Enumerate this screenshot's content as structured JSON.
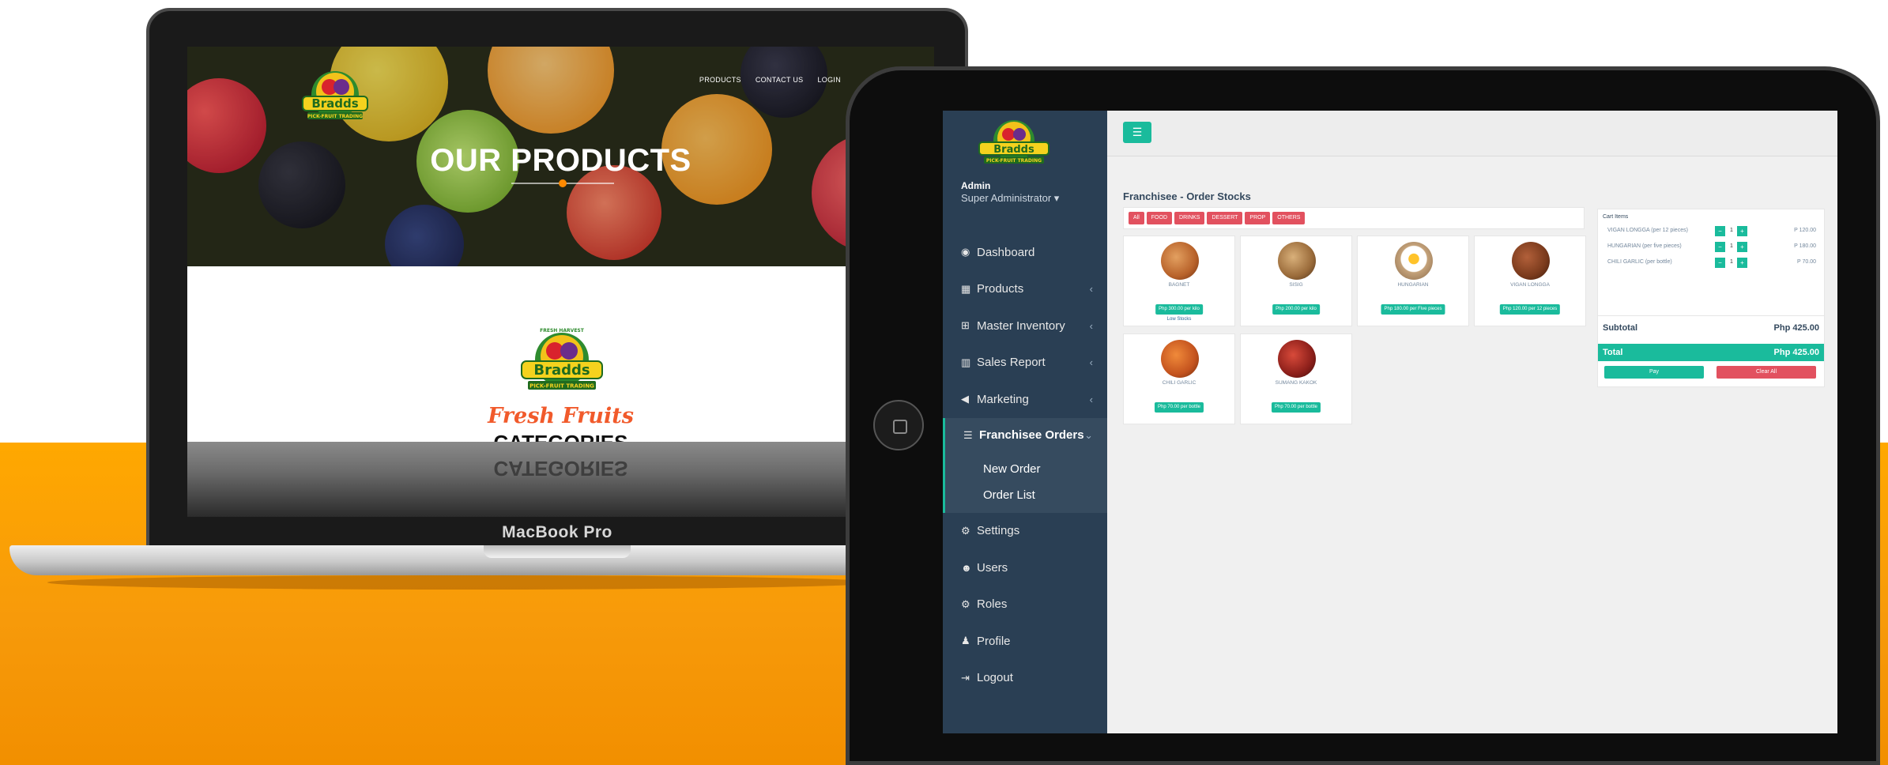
{
  "colors": {
    "accent": "#1abb9c",
    "danger": "#e2515f",
    "sidebar": "#2a3f54",
    "background_orange": "#f79a0a"
  },
  "laptop": {
    "nav": [
      "PRODUCTS",
      "CONTACT US",
      "LOGIN"
    ],
    "hero_title": "OUR PRODUCTS",
    "fresh_fruits": "Fresh Fruits",
    "categories": "CATEGORIES",
    "reflection": "CATEGORIES",
    "device_label": "MacBook Pro"
  },
  "logo": {
    "brand": "Bradds",
    "subtitle": "PICK-FRUIT TRADING",
    "badge": "FRESH HARVEST"
  },
  "sidebar": {
    "user_name": "Admin",
    "user_role": "Super Administrator ▾",
    "items": [
      {
        "label": "Dashboard",
        "icon": "dashboard-icon",
        "glyph": "◉"
      },
      {
        "label": "Products",
        "icon": "grid-icon",
        "glyph": "▦"
      },
      {
        "label": "Master Inventory",
        "icon": "cart-icon",
        "glyph": "⊞"
      },
      {
        "label": "Sales Report",
        "icon": "bar-chart-icon",
        "glyph": "▥"
      },
      {
        "label": "Marketing",
        "icon": "megaphone-icon",
        "glyph": "◀"
      },
      {
        "label": "Franchisee Orders",
        "icon": "list-icon",
        "glyph": "☰"
      },
      {
        "label": "Settings",
        "icon": "gear-icon",
        "glyph": "⚙"
      },
      {
        "label": "Users",
        "icon": "users-icon",
        "glyph": "☻"
      },
      {
        "label": "Roles",
        "icon": "roles-icon",
        "glyph": "⚙"
      },
      {
        "label": "Profile",
        "icon": "user-icon",
        "glyph": "♟"
      },
      {
        "label": "Logout",
        "icon": "logout-icon",
        "glyph": "⇥"
      }
    ],
    "submenu": [
      "New Order",
      "Order List"
    ]
  },
  "page": {
    "title": "Franchisee - Order Stocks",
    "filters": [
      "All",
      "FOOD",
      "DRINKS",
      "DESSERT",
      "PROP",
      "OTHERS"
    ]
  },
  "products": [
    {
      "name": "BAGNET",
      "price": "Php 300.00 per kilo",
      "note": "Low Stocks",
      "color": "#b8622a"
    },
    {
      "name": "SISIG",
      "price": "Php 200.00 per kilo",
      "note": "",
      "color": "#9a6b3a"
    },
    {
      "name": "HUNGARIAN",
      "price": "Php 180.00 per Five pieces",
      "note": "",
      "color": "#e8d9b4"
    },
    {
      "name": "VIGAN LONGGA",
      "price": "Php 120.00 per 12 pieces",
      "note": "",
      "color": "#7a3a1c"
    },
    {
      "name": "CHILI GARLIC",
      "price": "Php 70.00 per bottle",
      "note": "",
      "color": "#c4531e"
    },
    {
      "name": "SUMANG KAKOK",
      "price": "Php 70.00 per bottle",
      "note": "",
      "color": "#8c1f1a"
    }
  ],
  "cart": {
    "title": "Cart Items",
    "items": [
      {
        "name": "VIGAN LONGGA (per 12 pieces)",
        "qty": "1",
        "total": "P 120.00"
      },
      {
        "name": "HUNGARIAN (per five pieces)",
        "qty": "1",
        "total": "P 180.00"
      },
      {
        "name": "CHILI GARLIC (per bottle)",
        "qty": "1",
        "total": "P 70.00"
      }
    ],
    "subtotal_label": "Subtotal",
    "subtotal_value": "Php 425.00",
    "total_label": "Total",
    "total_value": "Php 425.00",
    "pay_label": "Pay",
    "clear_label": "Clear All",
    "minus": "−",
    "plus": "+"
  }
}
